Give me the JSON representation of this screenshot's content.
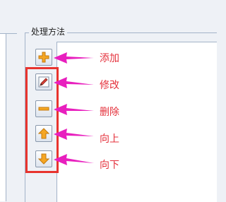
{
  "group": {
    "title": "处理方法"
  },
  "buttons": [
    {
      "id": "add",
      "icon": "plus-icon",
      "callout": "添加"
    },
    {
      "id": "edit",
      "icon": "pencil-icon",
      "callout": "修改"
    },
    {
      "id": "delete",
      "icon": "minus-icon",
      "callout": "删除"
    },
    {
      "id": "up",
      "icon": "arrow-up-icon",
      "callout": "向上"
    },
    {
      "id": "down",
      "icon": "arrow-down-icon",
      "callout": "向下"
    }
  ],
  "colors": {
    "annotation": "#e4303b",
    "icon_orange": "#f5a623",
    "panel_border": "#a3b3c8"
  }
}
